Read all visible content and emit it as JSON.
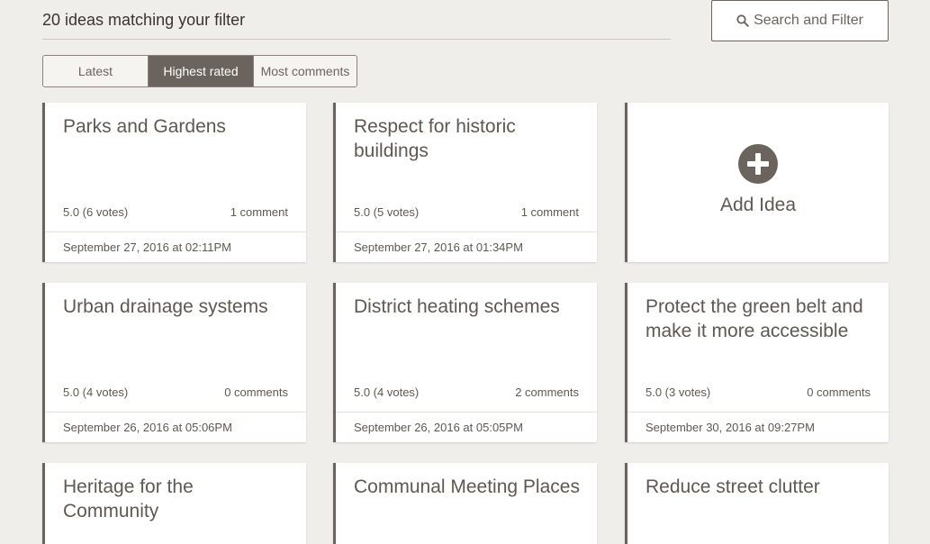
{
  "header": {
    "result_count_text": "20 ideas matching your filter"
  },
  "search": {
    "button_label": "Search and Filter"
  },
  "tabs": [
    {
      "label": "Latest",
      "active": false
    },
    {
      "label": "Highest rated",
      "active": true
    },
    {
      "label": "Most comments",
      "active": false
    }
  ],
  "add_idea": {
    "label": "Add Idea",
    "icon": "plus-circle-icon"
  },
  "ideas": [
    {
      "title": "Parks and Gardens",
      "rating": "5.0 (6 votes)",
      "comments": "1 comment",
      "date": "September 27, 2016 at 02:11PM"
    },
    {
      "title": "Respect for historic buildings",
      "rating": "5.0 (5 votes)",
      "comments": "1 comment",
      "date": "September 27, 2016 at 01:34PM"
    },
    {
      "title": "Urban drainage systems",
      "rating": "5.0 (4 votes)",
      "comments": "0 comments",
      "date": "September 26, 2016 at 05:06PM"
    },
    {
      "title": "District heating schemes",
      "rating": "5.0 (4 votes)",
      "comments": "2 comments",
      "date": "September 26, 2016 at 05:05PM"
    },
    {
      "title": "Protect the green belt and make it more accessible",
      "rating": "5.0 (3 votes)",
      "comments": "0 comments",
      "date": "September 30, 2016 at 09:27PM"
    },
    {
      "title": "Heritage for the Community"
    },
    {
      "title": "Communal Meeting Places"
    },
    {
      "title": "Reduce street clutter"
    }
  ],
  "colors": {
    "background": "#efeeeb",
    "accent": "#6b645e",
    "card": "#ffffff",
    "text": "#5f5852"
  }
}
